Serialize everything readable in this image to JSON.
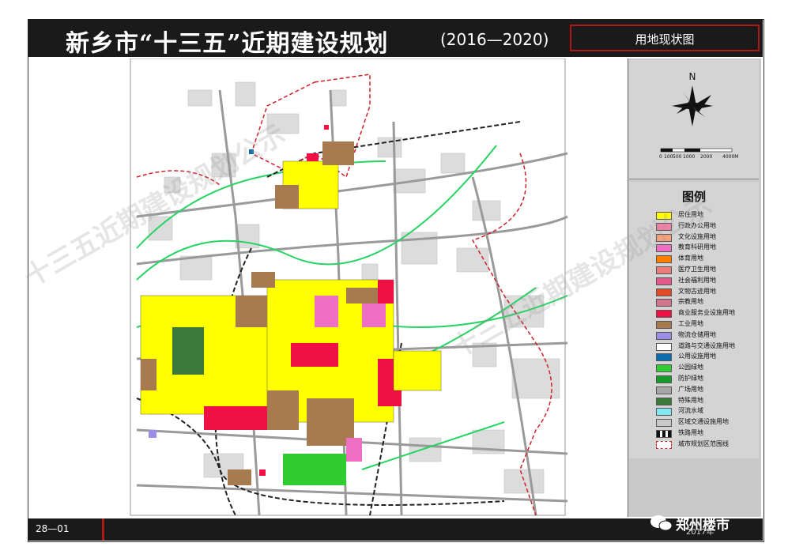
{
  "title": {
    "main": "新乡市“十三五”近期建设规划",
    "years": "(2016—2020)",
    "map_name": "用地现状图"
  },
  "compass": {
    "north_label": "N",
    "scale_ticks": [
      "0",
      "100",
      "500",
      "1000",
      "2000",
      "4000M"
    ]
  },
  "legend": {
    "title": "图例",
    "items": [
      {
        "label": "居住用地",
        "color": "#ffff00"
      },
      {
        "label": "行政办公用地",
        "color": "#f47fa8"
      },
      {
        "label": "文化设施用地",
        "color": "#f7a07a"
      },
      {
        "label": "教育科研用地",
        "color": "#ee6fc4"
      },
      {
        "label": "体育用地",
        "color": "#ff7f00"
      },
      {
        "label": "医疗卫生用地",
        "color": "#f07a7a"
      },
      {
        "label": "社会福利用地",
        "color": "#e05a8c"
      },
      {
        "label": "文物古迹用地",
        "color": "#e04d24"
      },
      {
        "label": "宗教用地",
        "color": "#d47590"
      },
      {
        "label": "商业服务业设施用地",
        "color": "#ee1144"
      },
      {
        "label": "工业用地",
        "color": "#a87a50"
      },
      {
        "label": "物流仓储用地",
        "color": "#9b8ee8"
      },
      {
        "label": "道路与交通设施用地",
        "color": "#ffffff"
      },
      {
        "label": "公用设施用地",
        "color": "#0a6eae"
      },
      {
        "label": "公园绿地",
        "color": "#30cc30"
      },
      {
        "label": "防护绿地",
        "color": "#159a2a"
      },
      {
        "label": "广场用地",
        "color": "#a6a6a6"
      },
      {
        "label": "特殊用地",
        "color": "#3a7a3a"
      },
      {
        "label": "河流水域",
        "color": "#7fe8f0"
      },
      {
        "label": "区域交通设施用地",
        "color": "#c9c9c9"
      },
      {
        "label": "铁路用地",
        "color": "#ffffff"
      },
      {
        "label": "城市规划区范围线",
        "color": "#ffffff"
      }
    ]
  },
  "footer": {
    "page_number": "28—01"
  },
  "logo": {
    "text": "郑州楼市",
    "year": "2017年"
  },
  "watermark": {
    "text": "十三五近期建设规划公示"
  }
}
